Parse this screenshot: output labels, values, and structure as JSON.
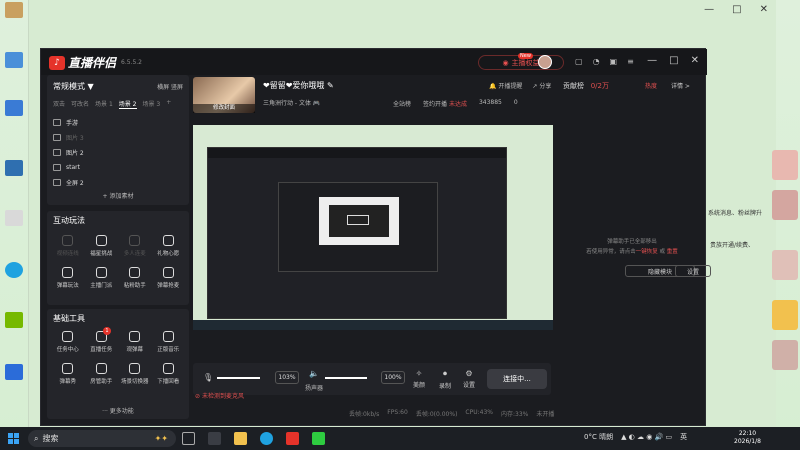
{
  "app": {
    "logo_text": "直播伴侣",
    "version": "6.5.5.2",
    "main_button": "主播权益",
    "new_badge": "New",
    "window_controls": [
      "—",
      "□",
      "✕"
    ]
  },
  "left": {
    "mode_label": "常规模式 ▼",
    "mode_right": "横屏  竖屏",
    "scene_tabs": [
      "双击",
      "可改名",
      "场景 1",
      "场景 2",
      "场景 3",
      "+"
    ],
    "active_scene_tab": 3,
    "sources": [
      {
        "label": "手游",
        "dim": false
      },
      {
        "label": "图片 3",
        "dim": true
      },
      {
        "label": "图片 2",
        "dim": false
      },
      {
        "label": "start",
        "dim": false
      },
      {
        "label": "全屏 2",
        "dim": false
      }
    ],
    "add_source": "+ 添加素材",
    "interactive": {
      "title": "互动玩法",
      "tools": [
        {
          "label": "视频连线",
          "dim": true
        },
        {
          "label": "福星挑战",
          "dim": false
        },
        {
          "label": "多人连麦",
          "dim": true
        },
        {
          "label": "礼物心愿",
          "dim": false
        },
        {
          "label": "弹幕玩法",
          "dim": false
        },
        {
          "label": "主播门派",
          "dim": false
        },
        {
          "label": "粘粉助手",
          "dim": false
        },
        {
          "label": "弹幕抢麦",
          "dim": false
        }
      ]
    },
    "basic": {
      "title": "基础工具",
      "tools": [
        {
          "label": "任务中心",
          "badge": ""
        },
        {
          "label": "直播任务",
          "badge": "1"
        },
        {
          "label": "观弹幕",
          "badge": ""
        },
        {
          "label": "正版音乐",
          "badge": ""
        },
        {
          "label": "弹幕秀",
          "badge": ""
        },
        {
          "label": "房管助手",
          "badge": ""
        },
        {
          "label": "场景切换器",
          "badge": ""
        },
        {
          "label": "下播回看",
          "badge": ""
        }
      ],
      "more": "··· 更多功能"
    }
  },
  "room": {
    "cover_label": "修改封面",
    "title": "❤留留❤爱你哦哦",
    "subtitle": "三角洲行动 - 文体  🎮",
    "stats": [
      "开播提醒",
      "分享"
    ],
    "meta": [
      "全站榜",
      "签约开播",
      "未达成",
      "343885",
      "0"
    ]
  },
  "controls": {
    "mic_pct": "103%",
    "mic_level": 0.8,
    "speaker_pct": "100%",
    "speaker_level": 0.78,
    "speaker_label": "扬声器",
    "beauty": "美颜",
    "record": "录制",
    "settings": "设置",
    "connect": "连接中...",
    "mic_warning": "未检测到麦克风"
  },
  "status": [
    "丢帧:0kb/s",
    "FPS:60",
    "丢帧:0(0.00%)",
    "CPU:43%",
    "内存:33%",
    "未开播"
  ],
  "right": {
    "contrib": "贡献榜",
    "contrib_val": "0/2万",
    "hot": "热度",
    "detail": "详情 >",
    "message_line1": "弹幕助手已全部移出",
    "message_line2_pre": "若使用异常，请点击",
    "message_link1": "一键恢复",
    "message_link2": "重置",
    "btn_hide": "隐藏模块",
    "btn_settings": "设置"
  },
  "desktop": {
    "side_text1": "系统消息、粉丝牌升",
    "side_text2": "贵族开通/续费、"
  },
  "taskbar": {
    "search": "搜索",
    "weather": "0°C 晴朗",
    "lang": "英",
    "time": "22:10",
    "date": "2026/1/8"
  }
}
